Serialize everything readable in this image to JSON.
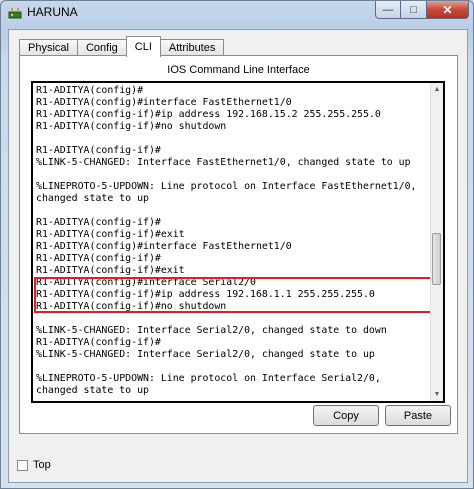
{
  "window": {
    "title": "HARUNA",
    "min_glyph": "—",
    "max_glyph": "□",
    "close_glyph": "✕"
  },
  "tabs": [
    {
      "label": "Physical",
      "active": false
    },
    {
      "label": "Config",
      "active": false
    },
    {
      "label": "CLI",
      "active": true
    },
    {
      "label": "Attributes",
      "active": false
    }
  ],
  "cli": {
    "title": "IOS Command Line Interface",
    "lines": [
      "R1-ADITYA(config)#",
      "R1-ADITYA(config)#interface FastEthernet1/0",
      "R1-ADITYA(config-if)#ip address 192.168.15.2 255.255.255.0",
      "R1-ADITYA(config-if)#no shutdown",
      "",
      "R1-ADITYA(config-if)#",
      "%LINK-5-CHANGED: Interface FastEthernet1/0, changed state to up",
      "",
      "%LINEPROTO-5-UPDOWN: Line protocol on Interface FastEthernet1/0,",
      "changed state to up",
      "",
      "R1-ADITYA(config-if)#",
      "R1-ADITYA(config-if)#exit",
      "R1-ADITYA(config)#interface FastEthernet1/0",
      "R1-ADITYA(config-if)#",
      "R1-ADITYA(config-if)#exit",
      "R1-ADITYA(config)#interface Serial2/0",
      "R1-ADITYA(config-if)#ip address 192.168.1.1 255.255.255.0",
      "R1-ADITYA(config-if)#no shutdown",
      "",
      "%LINK-5-CHANGED: Interface Serial2/0, changed state to down",
      "R1-ADITYA(config-if)#",
      "%LINK-5-CHANGED: Interface Serial2/0, changed state to up",
      "",
      "%LINEPROTO-5-UPDOWN: Line protocol on Interface Serial2/0,",
      "changed state to up"
    ],
    "highlight_color": "#e02020"
  },
  "buttons": {
    "copy": "Copy",
    "paste": "Paste"
  },
  "top_checkbox": {
    "label": "Top",
    "checked": false
  },
  "colors": {
    "title_bar": "#c7d8ec",
    "close_button": "#c74b37"
  }
}
